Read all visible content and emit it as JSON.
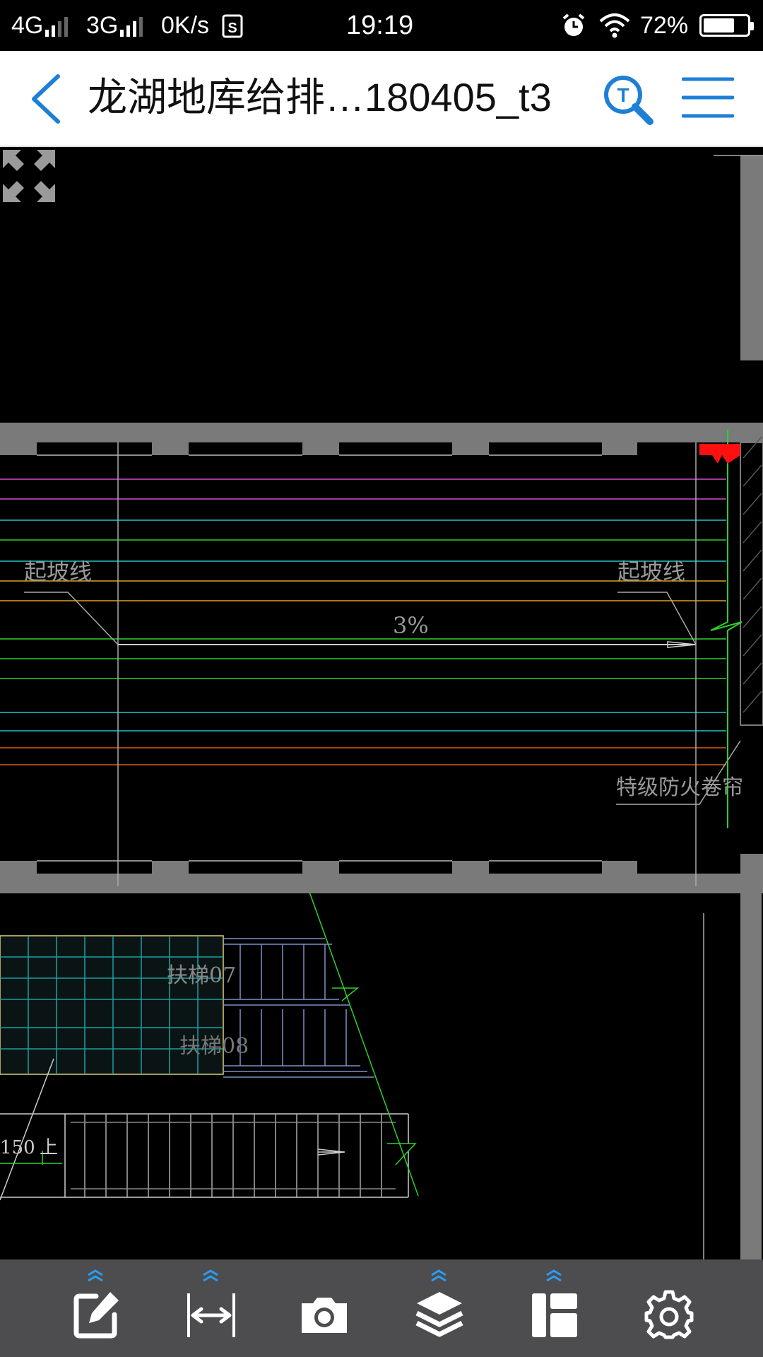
{
  "status_bar": {
    "network1": "4G",
    "network2": "3G",
    "speed": "0K/s",
    "time": "19:19",
    "battery": "72%",
    "battery_level": 0.72
  },
  "header": {
    "title": "龙湖地库给排…180405_t3",
    "icons": {
      "back": "chevron-left-icon",
      "search": "text-search-icon",
      "menu": "hamburger-menu-icon"
    },
    "accent_color": "#1e7fd6"
  },
  "drawing": {
    "labels": {
      "slope_start_left": "起坡线",
      "slope_start_right": "起坡线",
      "slope": "3%",
      "fire_shutter": "特级防火卷帘",
      "escalator_7": "扶梯07",
      "escalator_8": "扶梯08",
      "level_mark": "150",
      "up_mark": "上"
    }
  },
  "toolbar": {
    "background": "#4d4d4f",
    "items": [
      {
        "icon": "annotate-edit-icon",
        "expandable": true
      },
      {
        "icon": "measure-distance-icon",
        "expandable": true
      },
      {
        "icon": "camera-icon",
        "expandable": false
      },
      {
        "icon": "layers-icon",
        "expandable": true
      },
      {
        "icon": "layout-panel-icon",
        "expandable": true
      },
      {
        "icon": "settings-gear-icon",
        "expandable": false
      }
    ]
  }
}
